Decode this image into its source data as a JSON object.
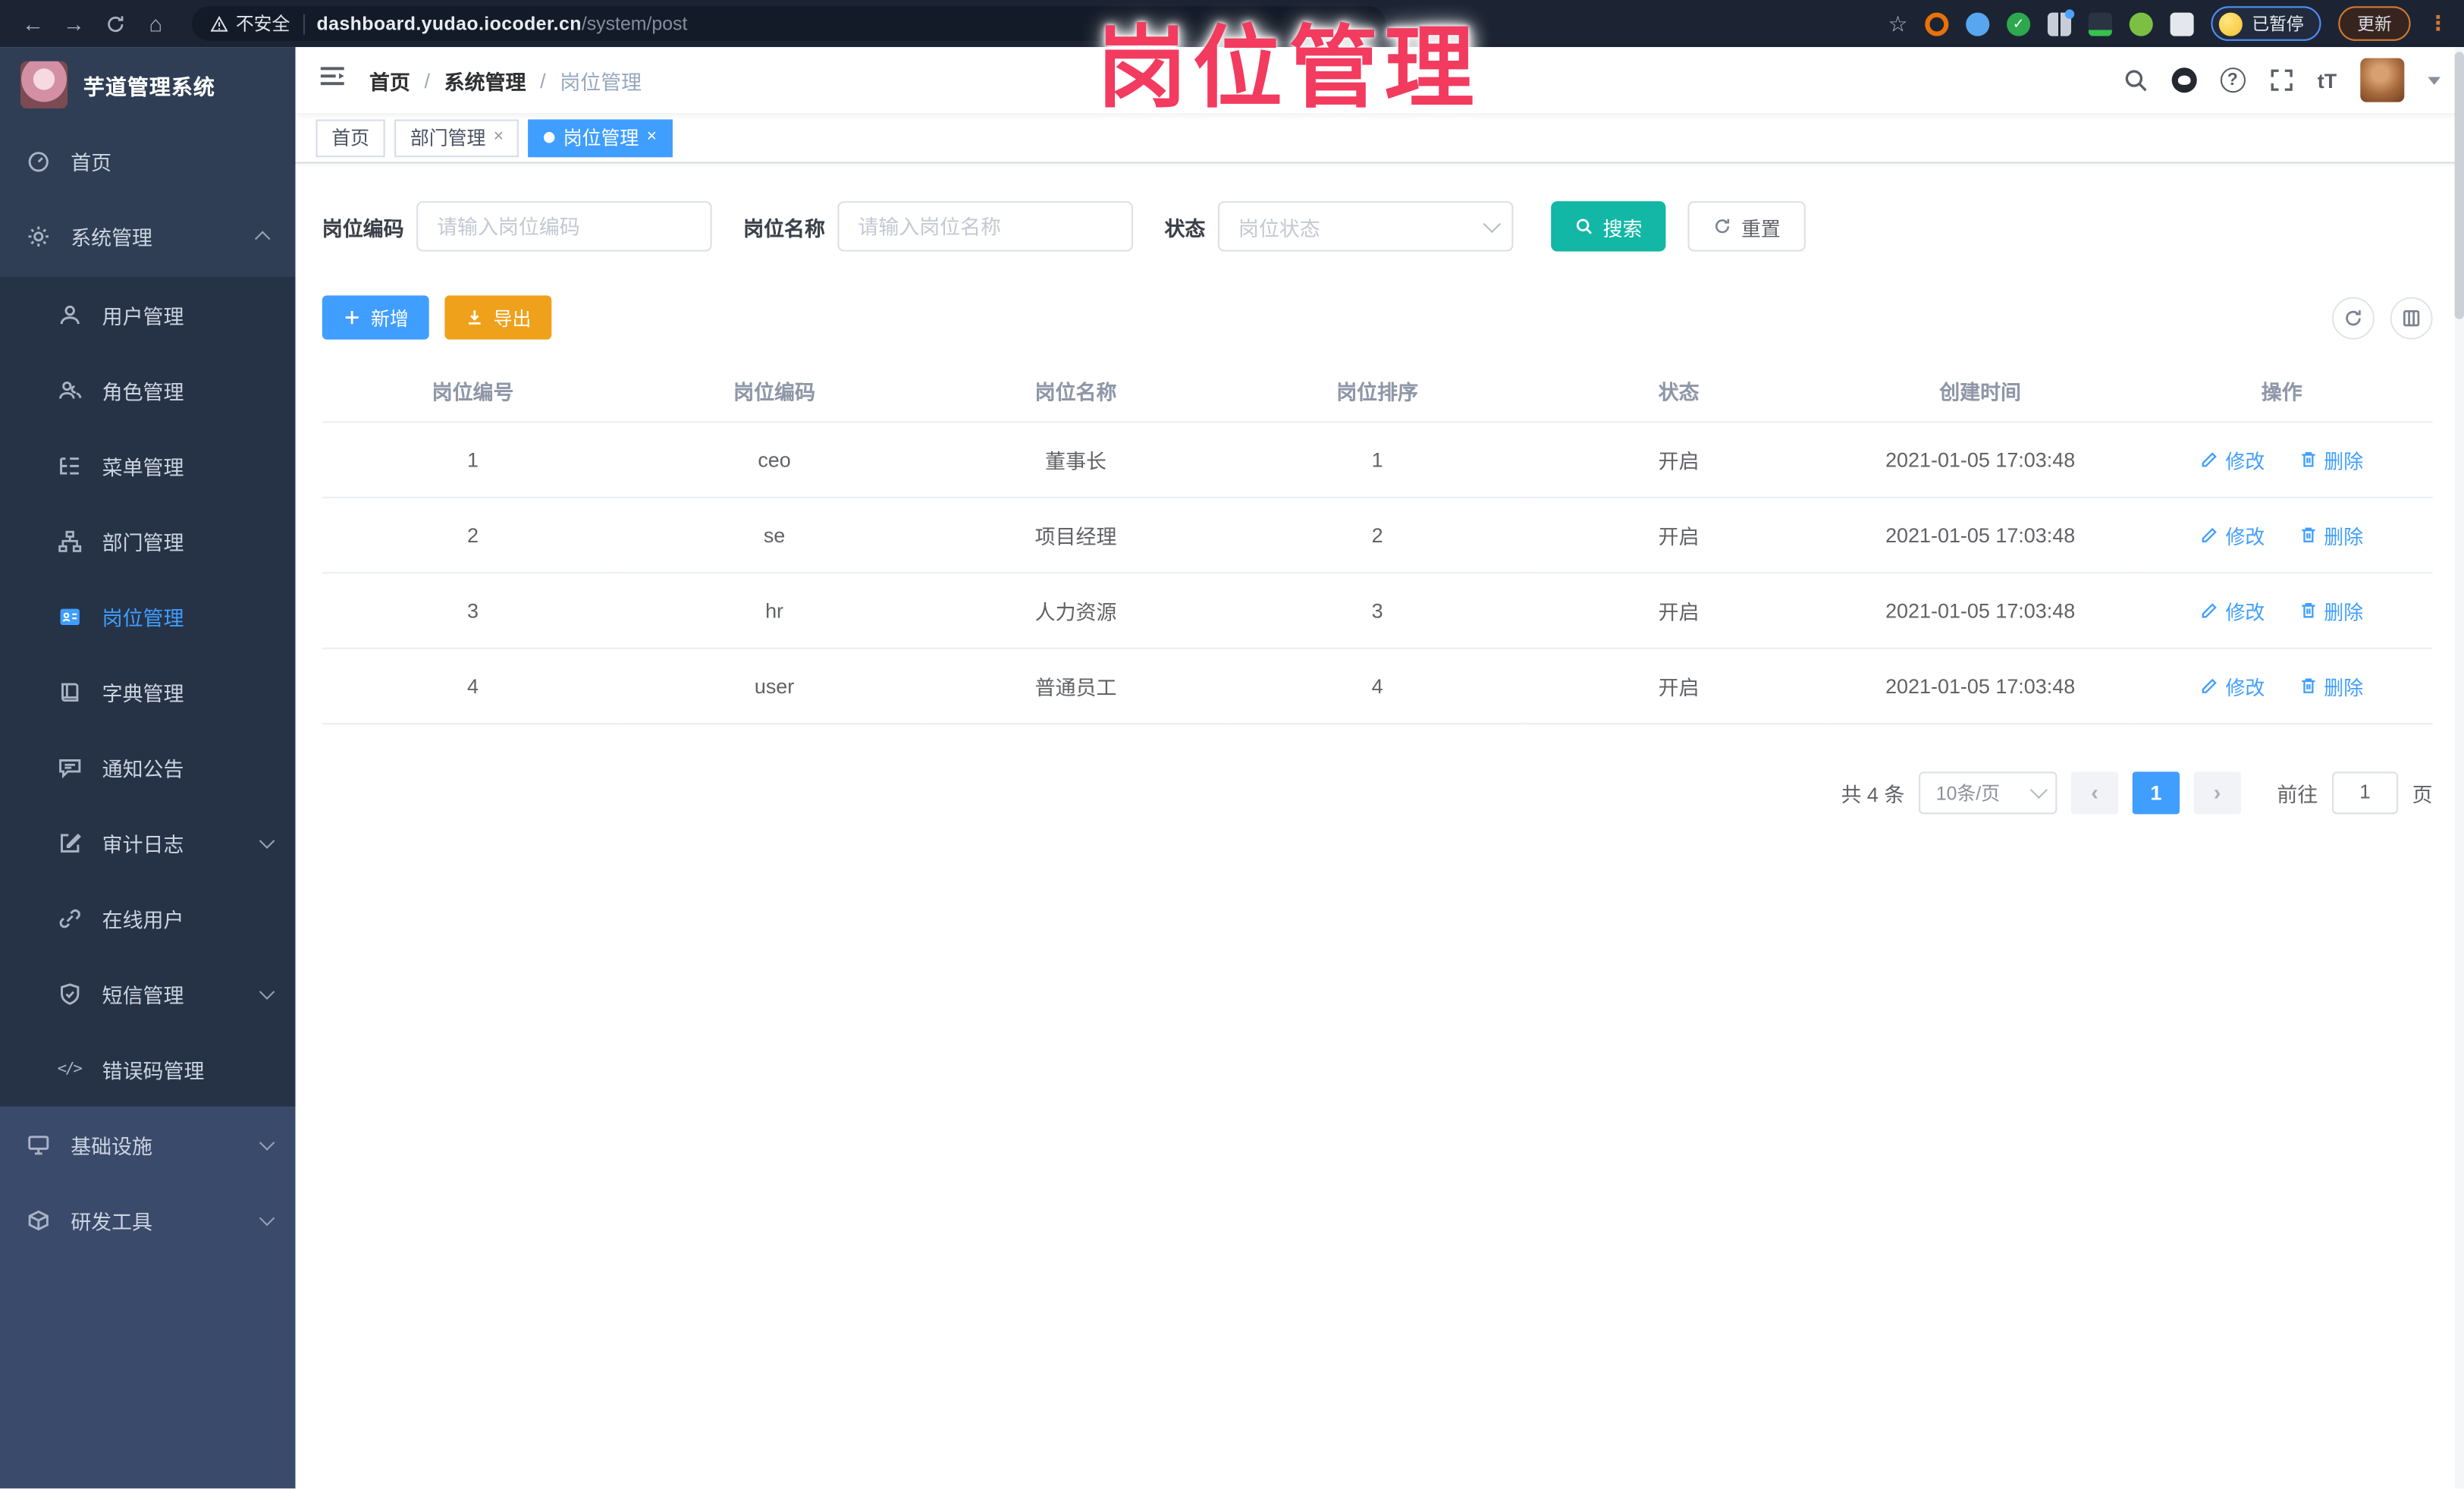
{
  "browser": {
    "security_label": "不安全",
    "url_host": "dashboard.yudao.iocoder.cn",
    "url_path": "/system/post",
    "paused_label": "已暂停",
    "update_label": "更新"
  },
  "icons": {
    "back": "←",
    "forward": "→",
    "home": "⌂",
    "star": "☆",
    "kebab": "⋮",
    "prev": "‹",
    "next": "›",
    "close": "×",
    "question": "?",
    "text_size": "tT",
    "code": "</>"
  },
  "watermark": "岗位管理",
  "sidebar": {
    "title": "芋道管理系统",
    "items": [
      {
        "label": "首页"
      },
      {
        "label": "系统管理"
      },
      {
        "label": "用户管理"
      },
      {
        "label": "角色管理"
      },
      {
        "label": "菜单管理"
      },
      {
        "label": "部门管理"
      },
      {
        "label": "岗位管理"
      },
      {
        "label": "字典管理"
      },
      {
        "label": "通知公告"
      },
      {
        "label": "审计日志"
      },
      {
        "label": "在线用户"
      },
      {
        "label": "短信管理"
      },
      {
        "label": "错误码管理"
      },
      {
        "label": "基础设施"
      },
      {
        "label": "研发工具"
      }
    ]
  },
  "header": {
    "breadcrumb": [
      "首页",
      "系统管理",
      "岗位管理"
    ],
    "breadcrumb_sep": "/"
  },
  "tabs": [
    {
      "label": "首页"
    },
    {
      "label": "部门管理"
    },
    {
      "label": "岗位管理"
    }
  ],
  "filters": {
    "code_label": "岗位编码",
    "code_placeholder": "请输入岗位编码",
    "name_label": "岗位名称",
    "name_placeholder": "请输入岗位名称",
    "status_label": "状态",
    "status_placeholder": "岗位状态",
    "search_label": "搜索",
    "reset_label": "重置"
  },
  "toolbar": {
    "add_label": "新增",
    "export_label": "导出"
  },
  "table": {
    "columns": [
      "岗位编号",
      "岗位编码",
      "岗位名称",
      "岗位排序",
      "状态",
      "创建时间",
      "操作"
    ],
    "edit_label": "修改",
    "delete_label": "删除",
    "rows": [
      {
        "id": "1",
        "code": "ceo",
        "name": "董事长",
        "sort": "1",
        "status": "开启",
        "created": "2021-01-05 17:03:48"
      },
      {
        "id": "2",
        "code": "se",
        "name": "项目经理",
        "sort": "2",
        "status": "开启",
        "created": "2021-01-05 17:03:48"
      },
      {
        "id": "3",
        "code": "hr",
        "name": "人力资源",
        "sort": "3",
        "status": "开启",
        "created": "2021-01-05 17:03:48"
      },
      {
        "id": "4",
        "code": "user",
        "name": "普通员工",
        "sort": "4",
        "status": "开启",
        "created": "2021-01-05 17:03:48"
      }
    ]
  },
  "pagination": {
    "total_label": "共 4 条",
    "page_size_label": "10条/页",
    "current_page": "1",
    "goto_label": "前往",
    "goto_value": "1",
    "page_unit": "页"
  },
  "colors": {
    "accent": "#409eff",
    "teal": "#12b7a6",
    "amber": "#f0a11c",
    "watermark_pink": "#f23b5f"
  }
}
